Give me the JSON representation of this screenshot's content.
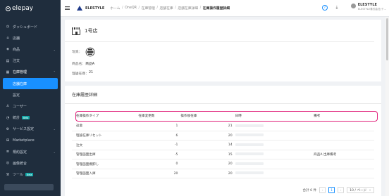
{
  "sidebar": {
    "logo": "elepay",
    "items": [
      {
        "label": "ダッシュボード",
        "icon": "dashboard-icon",
        "chevron": ""
      },
      {
        "label": "店舗",
        "icon": "store-icon",
        "chevron": ""
      },
      {
        "label": "商品",
        "icon": "tag-icon",
        "chevron": "⌄"
      },
      {
        "label": "注文",
        "icon": "order-icon",
        "chevron": ""
      },
      {
        "label": "在庫管理",
        "icon": "inventory-icon",
        "chevron": "⌃"
      },
      {
        "label": "店舗在庫",
        "icon": "",
        "chevron": ""
      },
      {
        "label": "設定",
        "icon": "",
        "chevron": ""
      },
      {
        "label": "ユーザー",
        "icon": "user-icon",
        "chevron": ""
      },
      {
        "label": "統計",
        "icon": "stats-icon",
        "chevron": "",
        "badge": "Beta"
      },
      {
        "label": "サービス設定",
        "icon": "settings-icon",
        "chevron": "⌄"
      },
      {
        "label": "Marketplace",
        "icon": "marketplace-icon",
        "chevron": ""
      },
      {
        "label": "規約設定",
        "icon": "terms-icon",
        "chevron": "⌄"
      },
      {
        "label": "画像統合",
        "icon": "image-icon",
        "chevron": ""
      },
      {
        "label": "ツール",
        "icon": "tool-icon",
        "chevron": "",
        "badge": "Beta"
      }
    ]
  },
  "topbar": {
    "store_name": "ELESTYLE",
    "breadcrumbs": [
      "ホーム",
      "OneQR",
      "在庫管理",
      "店舗在庫",
      "店舗在庫詳細",
      "在庫操作履歴詳細"
    ],
    "account_name": "ELESTYLE",
    "account_sub": "ELESTYLE株式会社(テ..."
  },
  "store_card": {
    "shop_name": "1号店",
    "photo_label": "写真：",
    "product_label": "商品名：",
    "product_value": "商品A",
    "stock_label": "理論在庫：",
    "stock_value": "21"
  },
  "history": {
    "title": "在庫履歴詳細",
    "columns": [
      "在庫操作タイプ",
      "在庫変更数",
      "操作後在庫",
      "日時",
      "備考"
    ],
    "rows": [
      {
        "type": "返金",
        "change": "1",
        "after": "21",
        "note": ""
      },
      {
        "type": "理論在庫リセット",
        "change": "6",
        "after": "20",
        "note": ""
      },
      {
        "type": "注文",
        "change": "-1",
        "after": "14",
        "note": ""
      },
      {
        "type": "管理画面出庫",
        "change": "-5",
        "after": "15",
        "note": "商品A 出庫備考"
      },
      {
        "type": "管理画面棚卸し",
        "change": "0",
        "after": "20",
        "note": ""
      },
      {
        "type": "管理画面入庫",
        "change": "20",
        "after": "20",
        "note": ""
      }
    ],
    "pager": {
      "total": "合計 6 件",
      "prev": "‹",
      "page": "1",
      "next": "›",
      "page_size": "10 / ページ"
    }
  },
  "colors": {
    "sidebar_bg": "#1f2d3d",
    "accent": "#1890ff",
    "highlight": "#e0217a"
  }
}
